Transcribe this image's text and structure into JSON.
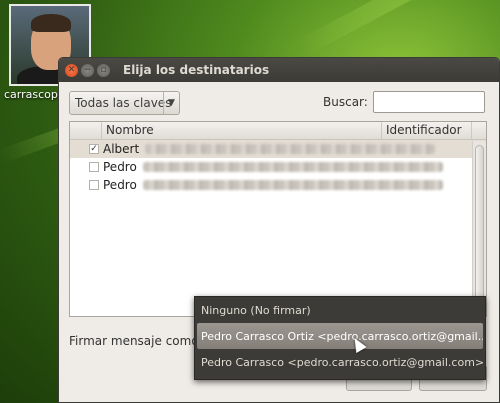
{
  "desktop": {
    "icon_label": "carrascop..."
  },
  "dialog": {
    "title": "Elija los destinatarios",
    "window_buttons": {
      "close_icon": "close-icon",
      "minimize_icon": "minimize-icon",
      "maximize_icon": "maximize-icon"
    },
    "filter_combo": {
      "selected": "Todas las claves",
      "arrow": "▼"
    },
    "search": {
      "label": "Buscar:",
      "value": ""
    },
    "list": {
      "columns": [
        "Nombre",
        "Identificador"
      ],
      "rows": [
        {
          "checked": true,
          "name": "Albert"
        },
        {
          "checked": false,
          "name": "Pedro"
        },
        {
          "checked": false,
          "name": "Pedro"
        }
      ]
    },
    "sign_label": "Firmar mensaje como:",
    "sign_dropdown": {
      "options": [
        "Ninguno (No firmar)",
        "Pedro Carrasco Ortiz <pedro.carrasco.ortiz@gmail....",
        "Pedro Carrasco <pedro.carrasco.ortiz@gmail.com>..."
      ],
      "hovered_index": 1
    }
  }
}
